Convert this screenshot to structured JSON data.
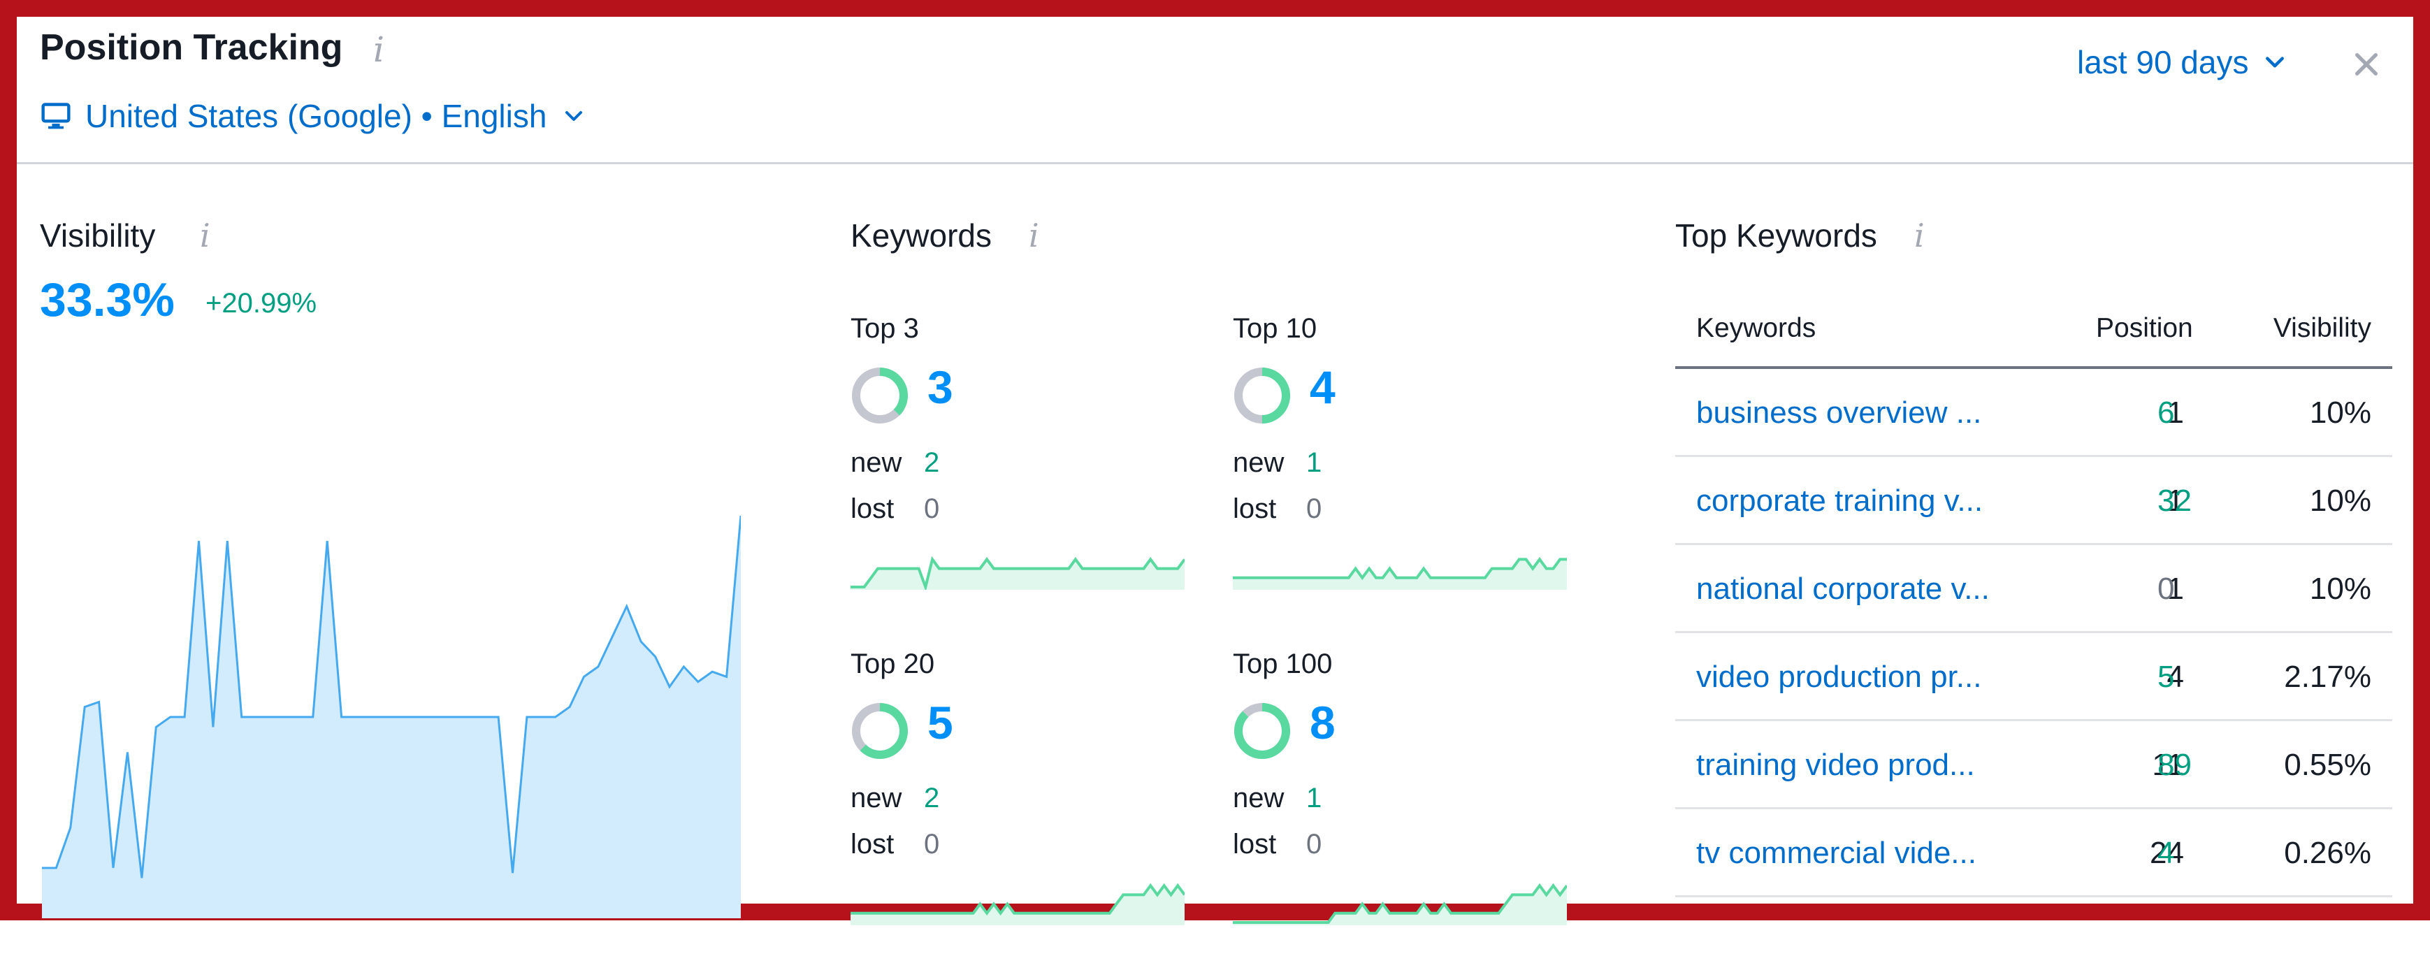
{
  "header": {
    "title": "Position Tracking",
    "info_glyph": "i",
    "location": "United States (Google) • English",
    "period": "last 90 days",
    "icons": [
      "info-icon",
      "monitor-icon",
      "chevron-down-icon",
      "close-icon"
    ]
  },
  "visibility": {
    "title": "Visibility",
    "value": "33.3%",
    "delta": "+20.99%",
    "chart_series": [
      10,
      10,
      18,
      42,
      43,
      10,
      33,
      8,
      38,
      40,
      40,
      75,
      38,
      75,
      40,
      40,
      40,
      40,
      40,
      40,
      75,
      40,
      40,
      40,
      40,
      40,
      40,
      40,
      40,
      40,
      40,
      40,
      40,
      9,
      40,
      40,
      40,
      42,
      48,
      50,
      56,
      62,
      55,
      52,
      46,
      50,
      47,
      49,
      48,
      80
    ]
  },
  "keywords": {
    "title": "Keywords",
    "new_label": "new",
    "lost_label": "lost",
    "blocks": [
      {
        "label": "Top 3",
        "count": "3",
        "new": "2",
        "lost": "0",
        "fraction": 0.375,
        "spark": [
          0,
          0,
          0,
          1,
          2,
          2,
          2,
          2,
          2,
          2,
          2,
          0,
          3,
          2,
          2,
          2,
          2,
          2,
          2,
          2,
          3,
          2,
          2,
          2,
          2,
          2,
          2,
          2,
          2,
          2,
          2,
          2,
          2,
          3,
          2,
          2,
          2,
          2,
          2,
          2,
          2,
          2,
          2,
          2,
          3,
          2,
          2,
          2,
          2,
          3
        ]
      },
      {
        "label": "Top 10",
        "count": "4",
        "new": "1",
        "lost": "0",
        "fraction": 0.5,
        "spark": [
          1,
          1,
          1,
          1,
          1,
          1,
          1,
          1,
          1,
          1,
          1,
          1,
          1,
          1,
          1,
          1,
          1,
          1,
          2,
          1,
          2,
          1,
          1,
          2,
          1,
          1,
          1,
          1,
          2,
          1,
          1,
          1,
          1,
          1,
          1,
          1,
          1,
          1,
          2,
          2,
          2,
          2,
          3,
          3,
          2,
          3,
          2,
          2,
          3,
          3
        ]
      },
      {
        "label": "Top 20",
        "count": "5",
        "new": "2",
        "lost": "0",
        "fraction": 0.625,
        "spark": [
          1,
          1,
          1,
          1,
          1,
          1,
          1,
          1,
          1,
          1,
          1,
          1,
          1,
          1,
          1,
          1,
          1,
          1,
          1,
          2,
          1,
          2,
          1,
          2,
          1,
          1,
          1,
          1,
          1,
          1,
          1,
          1,
          1,
          1,
          1,
          1,
          1,
          1,
          1,
          2,
          3,
          3,
          3,
          3,
          4,
          3,
          4,
          3,
          4,
          3
        ]
      },
      {
        "label": "Top 100",
        "count": "8",
        "new": "1",
        "lost": "0",
        "fraction": 0.875,
        "spark": [
          0,
          0,
          0,
          0,
          0,
          0,
          0,
          0,
          0,
          0,
          0,
          0,
          0,
          0,
          0,
          1,
          1,
          1,
          1,
          2,
          1,
          1,
          2,
          1,
          1,
          1,
          1,
          1,
          2,
          1,
          1,
          2,
          1,
          1,
          1,
          1,
          1,
          1,
          1,
          1,
          2,
          3,
          3,
          3,
          3,
          4,
          3,
          4,
          3,
          4
        ]
      }
    ]
  },
  "top_keywords": {
    "title": "Top Keywords",
    "columns": [
      "Keywords",
      "Position",
      "Visibility"
    ],
    "rows": [
      {
        "keyword": "business overview ...",
        "position": "1",
        "change": "6",
        "visibility": "10%"
      },
      {
        "keyword": "corporate training v...",
        "position": "1",
        "change": "32",
        "visibility": "10%"
      },
      {
        "keyword": "national corporate v...",
        "position": "1",
        "change": "0",
        "visibility": "10%"
      },
      {
        "keyword": "video production pr...",
        "position": "4",
        "change": "5",
        "visibility": "2.17%"
      },
      {
        "keyword": "training video prod...",
        "position": "11",
        "change": "89",
        "visibility": "0.55%"
      },
      {
        "keyword": "tv commercial vide...",
        "position": "24",
        "change": "4",
        "visibility": "0.26%"
      }
    ]
  },
  "colors": {
    "accent": "#008ff8",
    "link": "#006dca",
    "positive": "#009f81",
    "spark_line": "#59d9a0",
    "spark_fill": "#e0f7ee",
    "chart_line": "#45a9ef",
    "chart_fill": "#d2ecfd",
    "donut_empty": "#c4c7cf",
    "frame": "#b5121b"
  }
}
